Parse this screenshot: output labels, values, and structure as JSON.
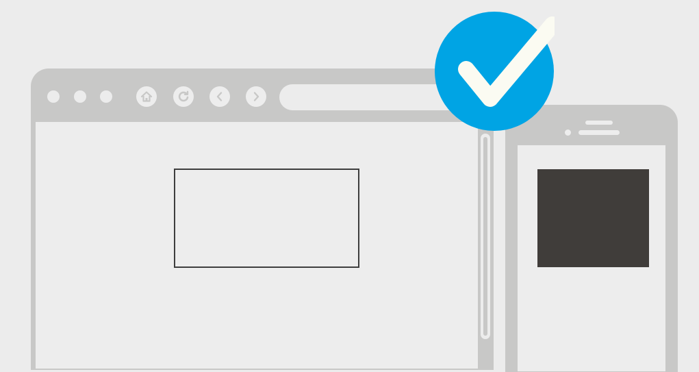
{
  "colors": {
    "background": "#ececec",
    "frame": "#c8c8c7",
    "viewport": "#ededed",
    "outline": "#3d3d3d",
    "image_fill": "#403d3a",
    "badge": "#00a4e4",
    "check": "#fbfbf2",
    "icon_stroke": "#c8c8c7"
  },
  "browser": {
    "window_controls": [
      "dot",
      "dot",
      "dot"
    ],
    "toolbar_icons": [
      "home-icon",
      "refresh-icon",
      "back-icon",
      "forward-icon"
    ]
  },
  "phone": {
    "content": "image-placeholder"
  },
  "badge": {
    "icon": "checkmark-icon"
  }
}
